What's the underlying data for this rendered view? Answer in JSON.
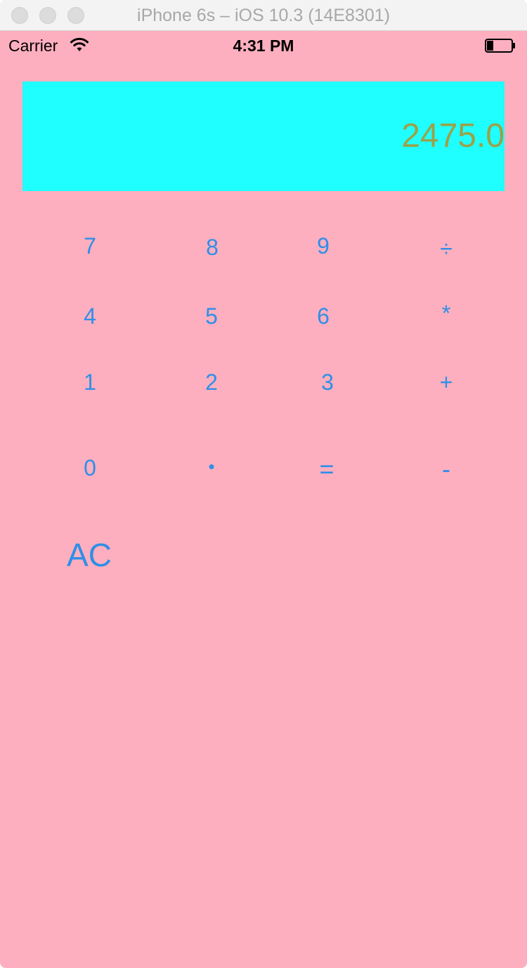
{
  "window": {
    "title": "iPhone 6s – iOS 10.3 (14E8301)"
  },
  "status_bar": {
    "carrier": "Carrier",
    "time": "4:31 PM"
  },
  "display": {
    "value": "2475.0"
  },
  "keypad": {
    "row1": [
      "7",
      "8",
      "9",
      "÷"
    ],
    "row2": [
      "4",
      "5",
      "6",
      "*"
    ],
    "row3": [
      "1",
      "2",
      "3",
      "+"
    ],
    "row4": [
      "0",
      "•",
      "=",
      "-"
    ],
    "clear": "AC"
  },
  "colors": {
    "background": "#fdafbf",
    "display_background": "#1fffff",
    "display_text": "#9aa24a",
    "key_text": "#2f8fe8"
  }
}
